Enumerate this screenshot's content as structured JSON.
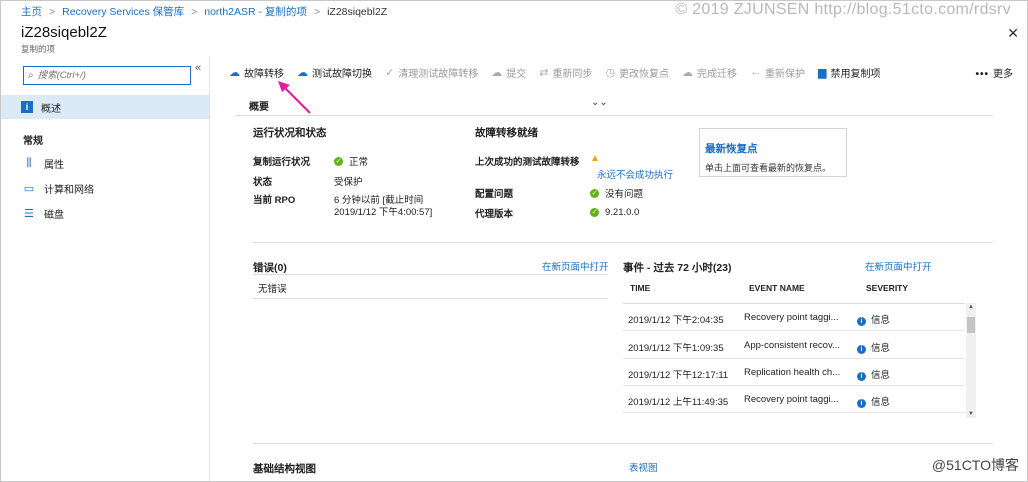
{
  "breadcrumb": [
    "主页",
    "Recovery Services 保管库",
    "north2ASR - 复制的项",
    "iZ28siqebl2Z"
  ],
  "watermark_top": "© 2019 ZJUNSEN http://blog.51cto.com/rdsrv",
  "header": {
    "title": "iZ28siqebl2Z",
    "subtitle": "复制的项"
  },
  "search": {
    "placeholder": "搜索(Ctrl+/)"
  },
  "nav": {
    "overview": "概述",
    "group": "常规",
    "items": [
      {
        "label": "属性",
        "icon": "properties-icon"
      },
      {
        "label": "计算和网络",
        "icon": "compute-network-icon"
      },
      {
        "label": "磁盘",
        "icon": "disk-icon"
      }
    ]
  },
  "toolbar": {
    "items": [
      {
        "label": "故障转移",
        "icon": "failover-icon",
        "enabled": true
      },
      {
        "label": "测试故障切换",
        "icon": "test-failover-icon",
        "enabled": true
      },
      {
        "label": "清理测试故障转移",
        "icon": "check-icon",
        "enabled": false
      },
      {
        "label": "提交",
        "icon": "commit-icon",
        "enabled": false
      },
      {
        "label": "重新同步",
        "icon": "resync-icon",
        "enabled": false
      },
      {
        "label": "更改恢复点",
        "icon": "clock-icon",
        "enabled": false
      },
      {
        "label": "完成迁移",
        "icon": "cloud-icon",
        "enabled": false
      },
      {
        "label": "重新保护",
        "icon": "back-arrow-icon",
        "enabled": false
      },
      {
        "label": "禁用复制项",
        "icon": "trash-icon",
        "enabled": true
      }
    ],
    "more": "更多"
  },
  "overview": {
    "label": "概要",
    "health": {
      "title": "运行状况和状态",
      "rows": [
        {
          "key": "复制运行状况",
          "value": "正常"
        },
        {
          "key": "状态",
          "value": "受保护"
        },
        {
          "key": "当前 RPO",
          "value": "6 分钟以前 [截止时间",
          "value2": "2019/1/12 下午4:00:57]"
        }
      ]
    },
    "failover": {
      "title": "故障转移就绪",
      "last_test_key": "上次成功的测试故障转移",
      "last_test_link": "永远不会成功执行",
      "config_key": "配置问题",
      "config_value": "没有问题",
      "agent_key": "代理版本",
      "agent_value": "9.21.0.0"
    },
    "latest_point": {
      "title": "最新恢复点",
      "desc": "单击上面可查看最新的恢复点。"
    }
  },
  "errors": {
    "title": "错误(0)",
    "open_link": "在新页面中打开",
    "empty": "无错误"
  },
  "events": {
    "title": "事件 - 过去 72 小时(23)",
    "open_link": "在新页面中打开",
    "columns": [
      "TIME",
      "EVENT NAME",
      "SEVERITY"
    ],
    "rows": [
      {
        "time": "2019/1/12 下午2:04:35",
        "name": "Recovery point taggi...",
        "severity": "信息"
      },
      {
        "time": "2019/1/12 下午1:09:35",
        "name": "App-consistent recov...",
        "severity": "信息"
      },
      {
        "time": "2019/1/12 下午12:17:11",
        "name": "Replication health ch...",
        "severity": "信息"
      },
      {
        "time": "2019/1/12 上午11:49:35",
        "name": "Recovery point taggi...",
        "severity": "信息"
      }
    ]
  },
  "infra": {
    "title": "基础结构视图",
    "table_view_link": "表视图"
  },
  "watermark_bot": "@51CTO博客",
  "colors": {
    "accent": "#1a6fc4",
    "ok": "#5fb319",
    "warning": "#f0a30a",
    "selected_nav": "#dceaf7",
    "arrow": "#e8199c"
  }
}
